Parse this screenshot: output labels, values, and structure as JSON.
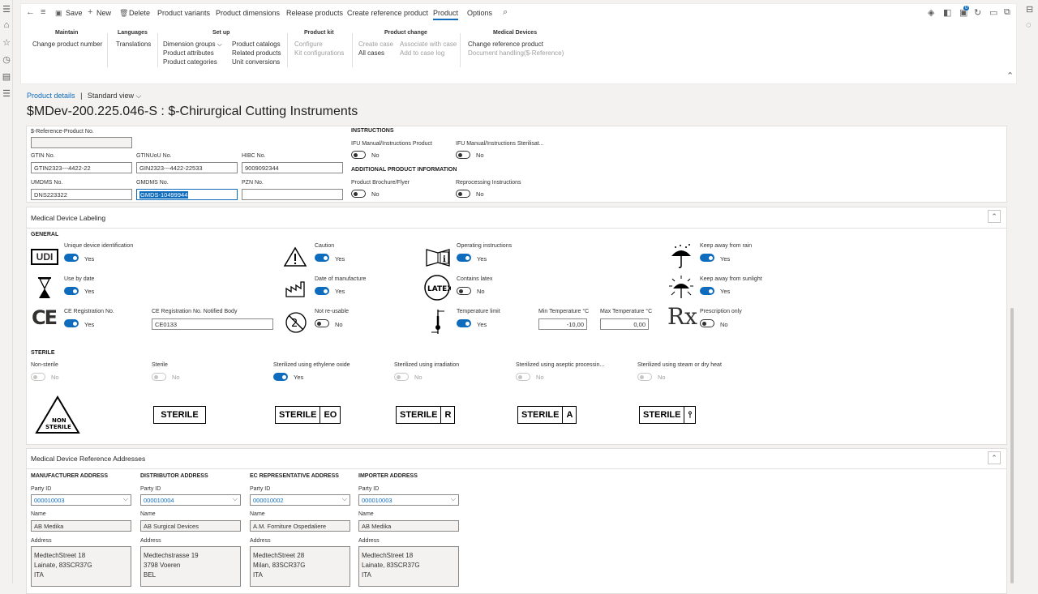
{
  "toolbar": {
    "save": "Save",
    "new": "New",
    "delete": "Delete",
    "tabs": [
      "Product variants",
      "Product dimensions",
      "Release products",
      "Create reference product",
      "Product",
      "Options"
    ]
  },
  "ribbon": {
    "maintain": {
      "title": "Maintain",
      "items": [
        "Change product number"
      ]
    },
    "languages": {
      "title": "Languages",
      "items": [
        "Translations"
      ]
    },
    "setup": {
      "title": "Set up",
      "col1": [
        "Dimension groups",
        "Product attributes",
        "Product categories"
      ],
      "col2": [
        "Product catalogs",
        "Related products",
        "Unit conversions"
      ]
    },
    "kit": {
      "title": "Product kit",
      "items": [
        "Configure",
        "Kit configurations"
      ]
    },
    "change": {
      "title": "Product change",
      "col1": [
        "Create case",
        "All cases"
      ],
      "col2": [
        "Associate with case",
        "Add to case log"
      ]
    },
    "medical": {
      "title": "Medical Devices",
      "items": [
        "Change reference product",
        "Document handling($-Reference)"
      ]
    }
  },
  "breadcrumb": {
    "link": "Product details",
    "sep": "|",
    "view": "Standard view"
  },
  "page_title": "$MDev-200.225.046-S : $-Chirurgical Cutting Instruments",
  "identifiers": {
    "ref_label": "$-Reference-Product No.",
    "ref_value": "",
    "gtin_label": "GTIN No.",
    "gtin_value": "GTIN2323---4422-22",
    "gtinuou_label": "GTINUoU No.",
    "gtinuou_value": "GIN2323---4422-22533",
    "hibc_label": "HIBC No.",
    "hibc_value": "9009092344",
    "umdms_label": "UMDMS No.",
    "umdms_value": "DNS223322",
    "gmdms_label": "GMDMS No.",
    "gmdms_value": "GMDS-10499944",
    "pzn_label": "PZN No.",
    "pzn_value": ""
  },
  "instructions": {
    "title": "INSTRUCTIONS",
    "ifu_product": "IFU Manual/Instructions Product",
    "ifu_product_val": "No",
    "ifu_steril": "IFU Manual/Instructions Sterilisat...",
    "ifu_steril_val": "No",
    "add_title": "ADDITIONAL PRODUCT INFORMATION",
    "brochure": "Product Brochure/Flyer",
    "brochure_val": "No",
    "reproc": "Reprocessing Instructions",
    "reproc_val": "No"
  },
  "labeling": {
    "header": "Medical Device Labeling",
    "general": "GENERAL",
    "udi": "Unique device identification",
    "udi_val": "Yes",
    "udi_icon": "UDI",
    "caution": "Caution",
    "caution_val": "Yes",
    "opinstr": "Operating instructions",
    "opinstr_val": "Yes",
    "rain": "Keep away from rain",
    "rain_val": "Yes",
    "usebydate": "Use by date",
    "usebydate_val": "Yes",
    "manufdate": "Date of manufacture",
    "manufdate_val": "Yes",
    "latex": "Contains latex",
    "latex_val": "No",
    "latex_icon": "LATEX",
    "sun": "Keep away from sunlight",
    "sun_val": "Yes",
    "ce": "CE Registration No.",
    "ce_val": "Yes",
    "ce_icon": "CE",
    "ce_nb_label": "CE Registration No. Notified Body",
    "ce_nb_value": "CE0133",
    "reuse": "Not re-usable",
    "reuse_val": "No",
    "temp": "Temperature limit",
    "temp_val": "Yes",
    "min_temp_label": "Min Temperature °C",
    "min_temp_value": "-10,00",
    "max_temp_label": "Max Temperature °C",
    "max_temp_value": "0,00",
    "rx": "Prescription only",
    "rx_val": "No",
    "rx_icon": "Rx"
  },
  "sterile": {
    "title": "STERILE",
    "items": [
      {
        "label": "Non-sterile",
        "val": "No"
      },
      {
        "label": "Sterile",
        "val": "No"
      },
      {
        "label": "Sterilized using ethylene oxide",
        "val": "Yes"
      },
      {
        "label": "Sterilized using irradiation",
        "val": "No"
      },
      {
        "label": "Sterilized using aseptic processin...",
        "val": "No"
      },
      {
        "label": "Sterilized using steam or dry heat",
        "val": "No"
      }
    ],
    "icons": {
      "non1": "NON",
      "non2": "STERILE",
      "sterile": "STERILE",
      "eo": "EO",
      "r": "R",
      "a": "A"
    }
  },
  "addresses": {
    "header": "Medical Device Reference Addresses",
    "party_label": "Party ID",
    "name_label": "Name",
    "address_label": "Address",
    "cols": [
      {
        "title": "MANUFACTURER ADDRESS",
        "party": "000010003",
        "name": "AB Medika",
        "address": "MedtechStreet 18\nLainate, 83SCR37G\nITA"
      },
      {
        "title": "DISTRIBUTOR ADDRESS",
        "party": "000010004",
        "name": "AB Surgical Devices",
        "address": "Medtechstrasse 19\n3798 Voeren\nBEL"
      },
      {
        "title": "EC REPRESENTATIVE ADDRESS",
        "party": "000010002",
        "name": "A.M. Forniture Ospedaliere",
        "address": "MedtechStreet 28\nMilan, 83SCR37G\nITA"
      },
      {
        "title": "IMPORTER ADDRESS",
        "party": "000010003",
        "name": "AB Medika",
        "address": "MedtechStreet 18\nLainate, 83SCR37G\nITA"
      }
    ]
  },
  "notification_count": "0",
  "colors": {
    "accent": "#0f6cbd"
  }
}
